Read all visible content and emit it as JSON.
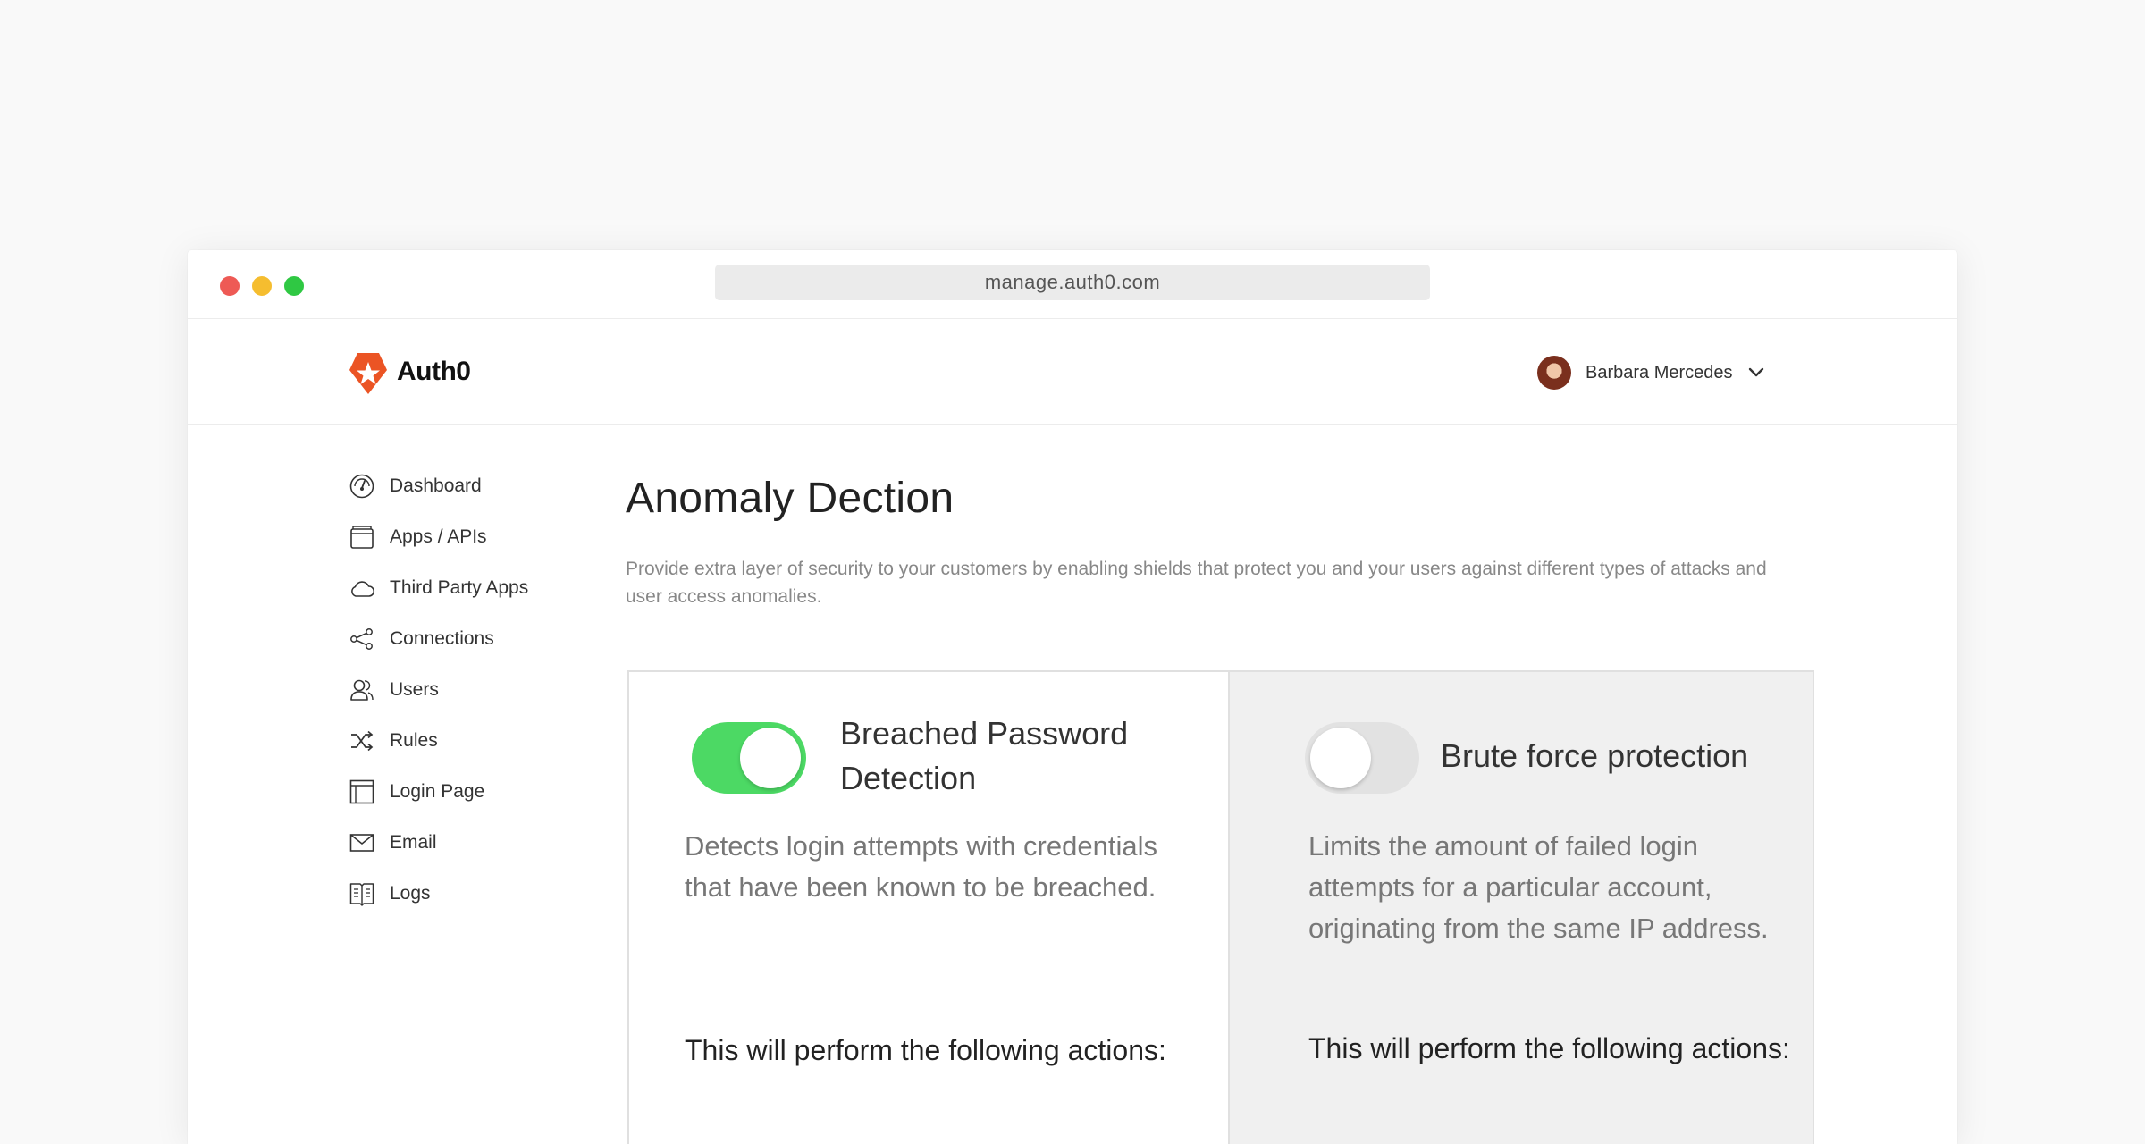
{
  "browser": {
    "url": "manage.auth0.com"
  },
  "header": {
    "brand": "Auth0",
    "user_name": "Barbara Mercedes"
  },
  "sidebar": {
    "items": [
      {
        "label": "Dashboard",
        "icon": "dashboard-icon"
      },
      {
        "label": "Apps / APIs",
        "icon": "apps-icon"
      },
      {
        "label": "Third Party Apps",
        "icon": "cloud-icon"
      },
      {
        "label": "Connections",
        "icon": "connections-icon"
      },
      {
        "label": "Users",
        "icon": "users-icon"
      },
      {
        "label": "Rules",
        "icon": "shuffle-icon"
      },
      {
        "label": "Login Page",
        "icon": "layout-icon"
      },
      {
        "label": "Email",
        "icon": "envelope-icon"
      },
      {
        "label": "Logs",
        "icon": "book-icon"
      }
    ]
  },
  "main": {
    "title": "Anomaly Dection",
    "description": "Provide extra layer of security to your customers by enabling shields that protect you and your users against different types of attacks and user access anomalies."
  },
  "cards": [
    {
      "title": "Breached Password Detection",
      "enabled": true,
      "description": "Detects login attempts with credentials that have been known to be breached.",
      "actions_label": "This will perform the following actions:"
    },
    {
      "title": "Brute force protection",
      "enabled": false,
      "description": "Limits the amount of failed login attempts for a particular account, originating from the same IP address.",
      "actions_label": "This will perform the following actions:"
    }
  ],
  "colors": {
    "toggle_on": "#4cd964",
    "toggle_off": "#e2e2e2",
    "brand_orange": "#eb5424",
    "disabled_card_bg": "#f0f0f0"
  }
}
